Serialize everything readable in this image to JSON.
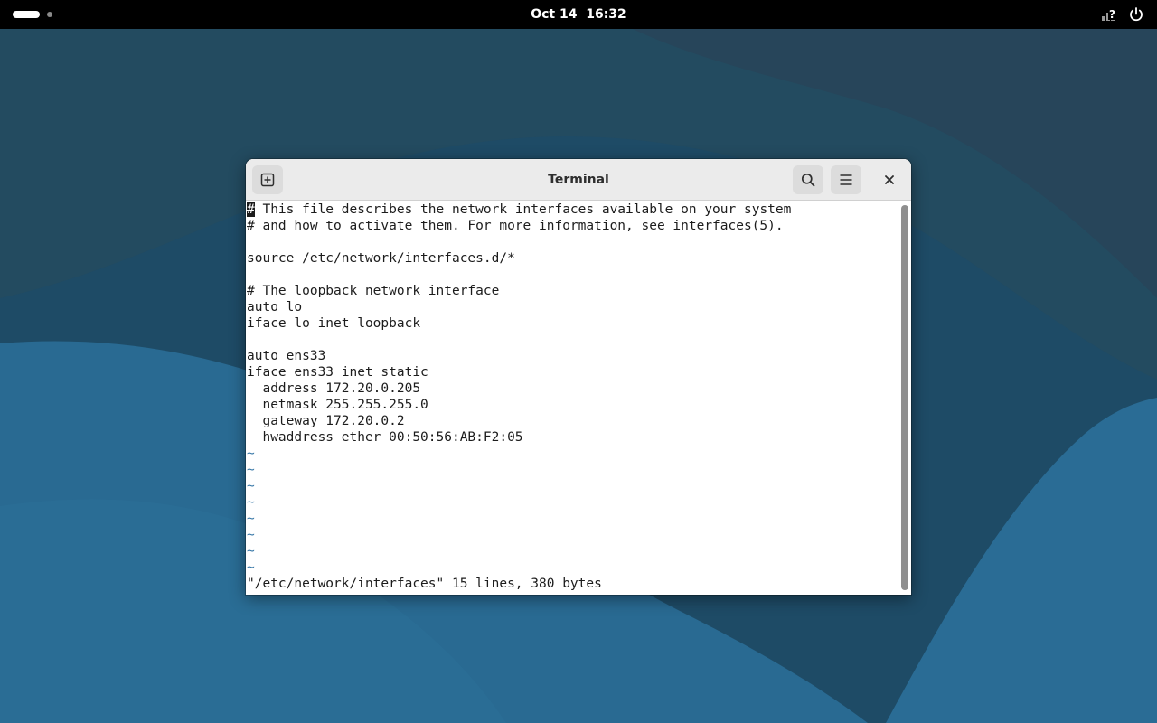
{
  "topbar": {
    "date": "Oct 14",
    "time": "16:32",
    "icons": [
      "network-unknown-icon",
      "power-icon"
    ]
  },
  "window": {
    "title": "Terminal",
    "buttons": {
      "new_tab": "new-tab-icon",
      "search": "search-icon",
      "menu": "hamburger-menu-icon",
      "close": "close-icon"
    }
  },
  "terminal": {
    "first_char": "#",
    "first_line_rest": " This file describes the network interfaces available on your system",
    "lines": [
      "# and how to activate them. For more information, see interfaces(5).",
      "",
      "source /etc/network/interfaces.d/*",
      "",
      "# The loopback network interface",
      "auto lo",
      "iface lo inet loopback",
      "",
      "auto ens33",
      "iface ens33 inet static",
      "  address 172.20.0.205",
      "  netmask 255.255.255.0",
      "  gateway 172.20.0.2",
      "  hwaddress ether 00:50:56:AB:F2:05"
    ],
    "tildes": [
      "~",
      "~",
      "~",
      "~",
      "~",
      "~",
      "~",
      "~"
    ],
    "status": "\"/etc/network/interfaces\" 15 lines, 380 bytes"
  },
  "colors": {
    "topbar": "#000000",
    "wallpaper": "#1f4d68",
    "tilde": "#3a79a8"
  }
}
